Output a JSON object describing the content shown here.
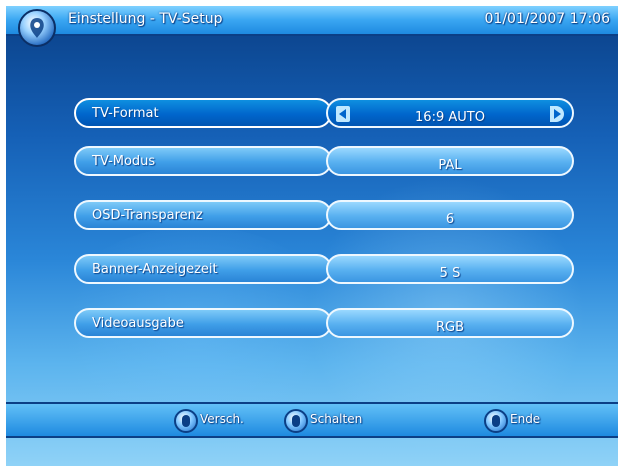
{
  "header": {
    "title": "Einstellung - TV-Setup",
    "datetime": "01/01/2007 17:06"
  },
  "menu": {
    "rows": [
      {
        "label": "TV-Format",
        "value": "16:9 AUTO",
        "selected": true
      },
      {
        "label": "TV-Modus",
        "value": "PAL"
      },
      {
        "label": "OSD-Transparenz",
        "value": "6"
      },
      {
        "label": "Banner-Anzeigezeit",
        "value": "5 S"
      },
      {
        "label": "Videoausgabe",
        "value": "RGB"
      }
    ]
  },
  "footer": {
    "hints": [
      {
        "icon": "navigate-key-icon",
        "label": "Versch."
      },
      {
        "icon": "switch-key-icon",
        "label": "Schalten"
      },
      {
        "icon": "exit-key-icon",
        "label": "Ende"
      }
    ]
  },
  "colors": {
    "accent": "#0066cc",
    "background_top": "#0a3f86",
    "background_bottom": "#8fd2f7",
    "text": "#ffffff"
  }
}
